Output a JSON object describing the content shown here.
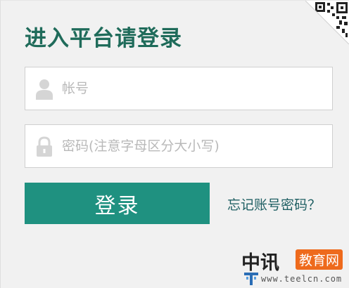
{
  "login": {
    "title": "进入平台请登录",
    "username": {
      "value": "",
      "placeholder": "帐号",
      "icon": "user-icon"
    },
    "password": {
      "value": "",
      "placeholder": "密码(注意字母区分大小写)",
      "icon": "lock-icon"
    },
    "submit_label": "登录",
    "forgot_label": "忘记账号密码？",
    "qr_icon": "qr-code-icon"
  },
  "watermark": {
    "brand": "中讯",
    "badge": "教育网",
    "url": "www.teelcn.com",
    "logo_icon": "teelcn-logo"
  },
  "colors": {
    "title": "#1f6b5a",
    "button": "#1f9180",
    "link": "#1f5f63",
    "badge": "#ee6a1c",
    "background": "#f1f1f1"
  }
}
